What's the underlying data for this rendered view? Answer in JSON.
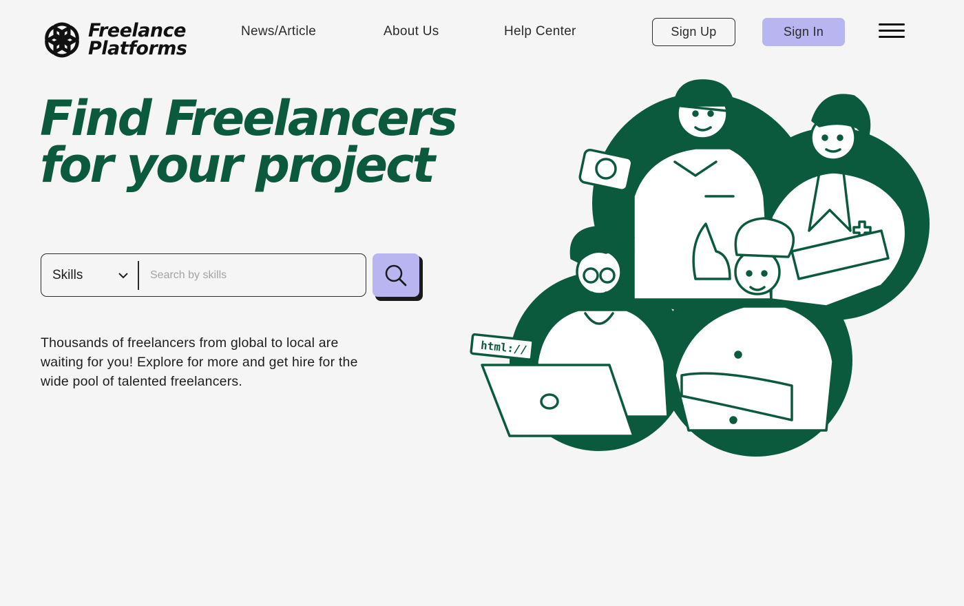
{
  "brand": {
    "line1": "Freelance",
    "line2": "Platforms"
  },
  "nav": {
    "news": "News/Article",
    "about": "About Us",
    "help": "Help Center"
  },
  "auth": {
    "signup": "Sign Up",
    "signin": "Sign In"
  },
  "hero": {
    "title_line1": "Find Freelancers",
    "title_line2": "for your project",
    "description": "Thousands of freelancers from global to local are waiting for you! Explore for more and get hire for the wide pool of talented freelancers."
  },
  "search": {
    "filter_selected": "Skills",
    "placeholder": "Search by skills",
    "value": ""
  },
  "illustration": {
    "laptop_label": "html://"
  },
  "colors": {
    "brand_green": "#0b5a3d",
    "accent_lavender": "#b9b5f1",
    "background": "#f5f5f5",
    "text_dark": "#1d1d1d"
  },
  "icons": [
    "logo-icon",
    "chevron-down-icon",
    "search-icon",
    "hamburger-menu-icon"
  ]
}
